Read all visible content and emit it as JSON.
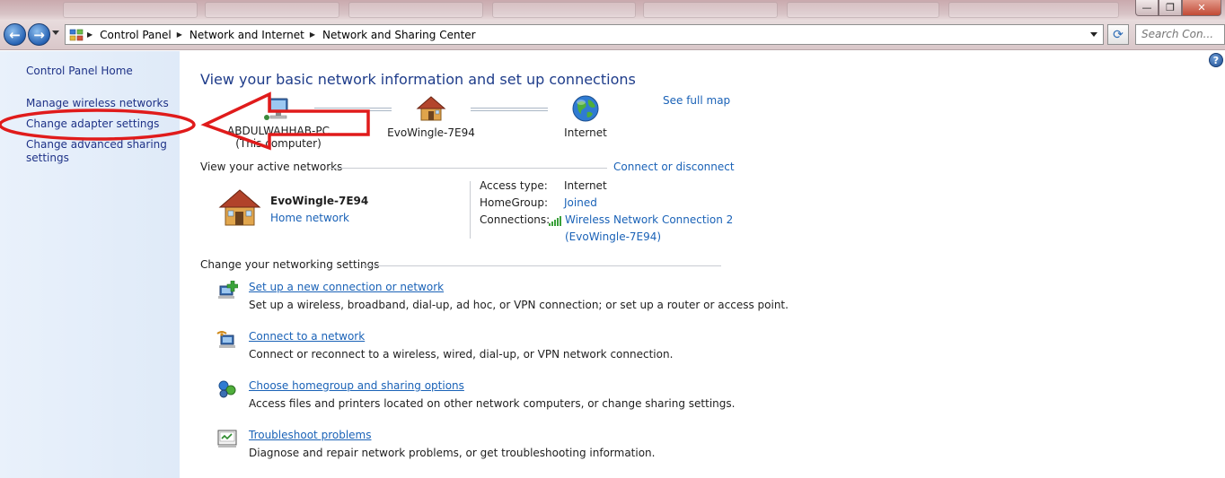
{
  "window": {
    "minimize_glyph": "—",
    "maximize_glyph": "❐",
    "close_glyph": "✕"
  },
  "navigation": {
    "back_glyph": "←",
    "forward_glyph": "→",
    "breadcrumb": [
      "Control Panel",
      "Network and Internet",
      "Network and Sharing Center"
    ],
    "refresh_glyph": "⟳",
    "search_placeholder": "Search Con..."
  },
  "left_pane": {
    "home": "Control Panel Home",
    "links": [
      "Manage wireless networks",
      "Change adapter settings",
      "Change advanced sharing settings"
    ],
    "advanced_line1": "Change advanced sharing",
    "advanced_line2": "settings"
  },
  "main": {
    "help_glyph": "?",
    "heading": "View your basic network information and set up connections",
    "see_full_map": "See full map",
    "map": {
      "computer_name": "ABDULWAHHAB-PC",
      "computer_sub": "(This computer)",
      "network_name": "EvoWingle-7E94",
      "internet": "Internet"
    },
    "active_networks": {
      "label": "View your active networks",
      "connect_link": "Connect or disconnect",
      "network_name": "EvoWingle-7E94",
      "network_type": "Home network",
      "access_type_label": "Access type:",
      "access_type_value": "Internet",
      "homegroup_label": "HomeGroup:",
      "homegroup_value": "Joined",
      "connections_label": "Connections:",
      "connection_line1": "Wireless Network Connection 2",
      "connection_line2": "(EvoWingle-7E94)"
    },
    "settings": {
      "label": "Change your networking settings",
      "tasks": [
        {
          "link": "Set up a new connection or network",
          "desc": "Set up a wireless, broadband, dial-up, ad hoc, or VPN connection; or set up a router or access point."
        },
        {
          "link": "Connect to a network",
          "desc": "Connect or reconnect to a wireless, wired, dial-up, or VPN network connection."
        },
        {
          "link": "Choose homegroup and sharing options",
          "desc": "Access files and printers located on other network computers, or change sharing settings."
        },
        {
          "link": "Troubleshoot problems",
          "desc": "Diagnose and repair network problems, or get troubleshooting information."
        }
      ]
    }
  },
  "colors": {
    "link": "#1a62b7",
    "heading": "#1e3c8a",
    "left_link": "#1e3287",
    "annotation": "#e01b1b",
    "left_pane_bg": "#e4eef9"
  }
}
